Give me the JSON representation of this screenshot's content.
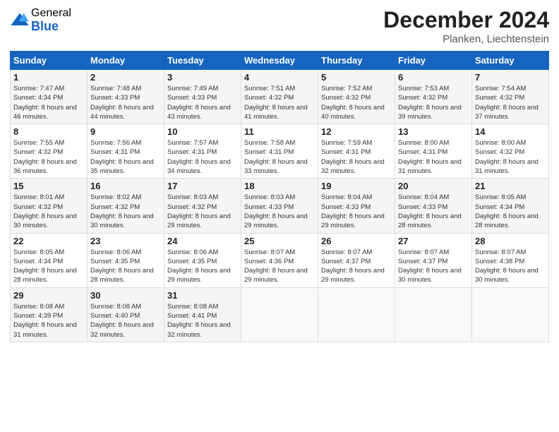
{
  "logo": {
    "general": "General",
    "blue": "Blue"
  },
  "title": "December 2024",
  "location": "Planken, Liechtenstein",
  "days_of_week": [
    "Sunday",
    "Monday",
    "Tuesday",
    "Wednesday",
    "Thursday",
    "Friday",
    "Saturday"
  ],
  "weeks": [
    [
      {
        "day": "1",
        "sunrise": "7:47 AM",
        "sunset": "4:34 PM",
        "daylight": "8 hours and 46 minutes."
      },
      {
        "day": "2",
        "sunrise": "7:48 AM",
        "sunset": "4:33 PM",
        "daylight": "8 hours and 44 minutes."
      },
      {
        "day": "3",
        "sunrise": "7:49 AM",
        "sunset": "4:33 PM",
        "daylight": "8 hours and 43 minutes."
      },
      {
        "day": "4",
        "sunrise": "7:51 AM",
        "sunset": "4:32 PM",
        "daylight": "8 hours and 41 minutes."
      },
      {
        "day": "5",
        "sunrise": "7:52 AM",
        "sunset": "4:32 PM",
        "daylight": "8 hours and 40 minutes."
      },
      {
        "day": "6",
        "sunrise": "7:53 AM",
        "sunset": "4:32 PM",
        "daylight": "8 hours and 39 minutes."
      },
      {
        "day": "7",
        "sunrise": "7:54 AM",
        "sunset": "4:32 PM",
        "daylight": "8 hours and 37 minutes."
      }
    ],
    [
      {
        "day": "8",
        "sunrise": "7:55 AM",
        "sunset": "4:32 PM",
        "daylight": "8 hours and 36 minutes."
      },
      {
        "day": "9",
        "sunrise": "7:56 AM",
        "sunset": "4:31 PM",
        "daylight": "8 hours and 35 minutes."
      },
      {
        "day": "10",
        "sunrise": "7:57 AM",
        "sunset": "4:31 PM",
        "daylight": "8 hours and 34 minutes."
      },
      {
        "day": "11",
        "sunrise": "7:58 AM",
        "sunset": "4:31 PM",
        "daylight": "8 hours and 33 minutes."
      },
      {
        "day": "12",
        "sunrise": "7:59 AM",
        "sunset": "4:31 PM",
        "daylight": "8 hours and 32 minutes."
      },
      {
        "day": "13",
        "sunrise": "8:00 AM",
        "sunset": "4:31 PM",
        "daylight": "8 hours and 31 minutes."
      },
      {
        "day": "14",
        "sunrise": "8:00 AM",
        "sunset": "4:32 PM",
        "daylight": "8 hours and 31 minutes."
      }
    ],
    [
      {
        "day": "15",
        "sunrise": "8:01 AM",
        "sunset": "4:32 PM",
        "daylight": "8 hours and 30 minutes."
      },
      {
        "day": "16",
        "sunrise": "8:02 AM",
        "sunset": "4:32 PM",
        "daylight": "8 hours and 30 minutes."
      },
      {
        "day": "17",
        "sunrise": "8:03 AM",
        "sunset": "4:32 PM",
        "daylight": "8 hours and 29 minutes."
      },
      {
        "day": "18",
        "sunrise": "8:03 AM",
        "sunset": "4:33 PM",
        "daylight": "8 hours and 29 minutes."
      },
      {
        "day": "19",
        "sunrise": "8:04 AM",
        "sunset": "4:33 PM",
        "daylight": "8 hours and 29 minutes."
      },
      {
        "day": "20",
        "sunrise": "8:04 AM",
        "sunset": "4:33 PM",
        "daylight": "8 hours and 28 minutes."
      },
      {
        "day": "21",
        "sunrise": "8:05 AM",
        "sunset": "4:34 PM",
        "daylight": "8 hours and 28 minutes."
      }
    ],
    [
      {
        "day": "22",
        "sunrise": "8:05 AM",
        "sunset": "4:34 PM",
        "daylight": "8 hours and 28 minutes."
      },
      {
        "day": "23",
        "sunrise": "8:06 AM",
        "sunset": "4:35 PM",
        "daylight": "8 hours and 28 minutes."
      },
      {
        "day": "24",
        "sunrise": "8:06 AM",
        "sunset": "4:35 PM",
        "daylight": "8 hours and 29 minutes."
      },
      {
        "day": "25",
        "sunrise": "8:07 AM",
        "sunset": "4:36 PM",
        "daylight": "8 hours and 29 minutes."
      },
      {
        "day": "26",
        "sunrise": "8:07 AM",
        "sunset": "4:37 PM",
        "daylight": "8 hours and 29 minutes."
      },
      {
        "day": "27",
        "sunrise": "8:07 AM",
        "sunset": "4:37 PM",
        "daylight": "8 hours and 30 minutes."
      },
      {
        "day": "28",
        "sunrise": "8:07 AM",
        "sunset": "4:38 PM",
        "daylight": "8 hours and 30 minutes."
      }
    ],
    [
      {
        "day": "29",
        "sunrise": "8:08 AM",
        "sunset": "4:39 PM",
        "daylight": "8 hours and 31 minutes."
      },
      {
        "day": "30",
        "sunrise": "8:08 AM",
        "sunset": "4:40 PM",
        "daylight": "8 hours and 32 minutes."
      },
      {
        "day": "31",
        "sunrise": "8:08 AM",
        "sunset": "4:41 PM",
        "daylight": "8 hours and 32 minutes."
      },
      null,
      null,
      null,
      null
    ]
  ],
  "labels": {
    "sunrise": "Sunrise: ",
    "sunset": "Sunset: ",
    "daylight": "Daylight: "
  }
}
